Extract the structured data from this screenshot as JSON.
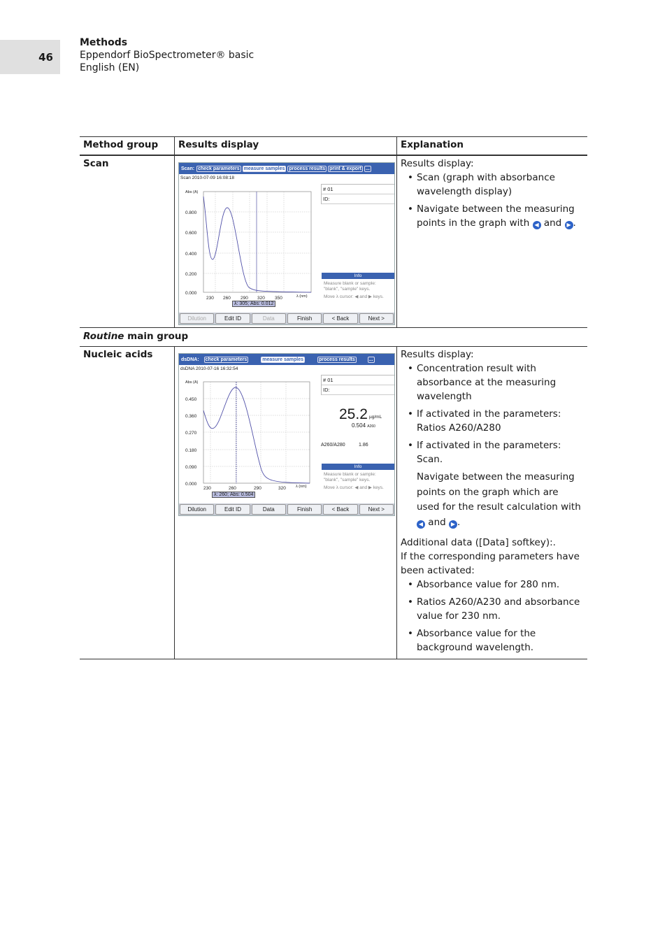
{
  "page_number": "46",
  "header": {
    "section": "Methods",
    "product": "Eppendorf BioSpectrometer® basic",
    "language": "English (EN)"
  },
  "table": {
    "headers": [
      "Method group",
      "Results display",
      "Explanation"
    ],
    "scan_row": {
      "group": "Scan",
      "intro": "Results display:",
      "bullets": [
        "Scan (graph with absorbance wavelength display)",
        "Navigate between the measuring points in the graph with"
      ],
      "and": "and"
    },
    "routine_row": {
      "italic": "Routine",
      "rest": " main group"
    },
    "nucleic_row": {
      "group": "Nucleic acids",
      "intro": "Results display:",
      "bullets": [
        "Concentration result with absorbance at the measuring wavelength",
        "If activated in the parameters: Ratios A260/A280",
        "If activated in the parameters: Scan."
      ],
      "navigate": "Navigate between the measuring points on the graph which are used for the result calculation with",
      "and": "and",
      "additional": "Additional data ([Data] softkey):.",
      "if_params": "If the corresponding parameters have been activated:",
      "bullets2": [
        "Absorbance value for 280 nm.",
        "Ratios A260/A230 and absorbance value for 230 nm.",
        "Absorbance value for the background wavelength."
      ]
    }
  },
  "screen_scan": {
    "tabs": [
      "Scan:",
      "check parameters",
      "measure samples",
      "process results",
      "print & export",
      "..."
    ],
    "timestamp": "Scan 2010-07-09 16:08:18",
    "yaxis": "Abs (A)",
    "yticks": [
      "0.800",
      "0.600",
      "0.400",
      "0.200",
      "0.000"
    ],
    "xticks": [
      "230",
      "260",
      "290",
      "320",
      "350"
    ],
    "xaxis": "λ (nm)",
    "cursor": "λ: 305; Abs: 0.012",
    "sample": "# 01",
    "id": "ID:",
    "info_title": "Info",
    "info1": "Measure blank or sample: \"blank\", \"sample\" keys.",
    "info2": "Move λ cursor: ◀ and ▶ keys.",
    "buttons": [
      "Dilution",
      "Edit ID",
      "Data",
      "Finish",
      "< Back",
      "Next >"
    ]
  },
  "screen_dna": {
    "tabs": [
      "dsDNA:",
      "check parameters",
      "measure samples",
      "process results",
      "..."
    ],
    "timestamp": "dsDNA 2010-07-16 16:32:54",
    "yaxis": "Abs (A)",
    "yticks": [
      "0.450",
      "0.360",
      "0.270",
      "0.180",
      "0.090",
      "0.000"
    ],
    "xticks": [
      "230",
      "260",
      "290",
      "320"
    ],
    "xaxis": "λ (nm)",
    "cursor": "λ: 260; Abs: 0.504",
    "sample": "# 01",
    "id": "ID:",
    "conc": "25.2",
    "conc_unit": "µg/mL",
    "abs": "0.504",
    "abs_unit": "A260",
    "ratio_label": "A260/A280",
    "ratio": "1.86",
    "info_title": "Info",
    "info1": "Measure blank or sample: \"blank\", \"sample\" keys.",
    "info2": "Move λ cursor: ◀ and ▶ keys.",
    "buttons": [
      "Dilution",
      "Edit ID",
      "Data",
      "Finish",
      "< Back",
      "Next >"
    ]
  }
}
